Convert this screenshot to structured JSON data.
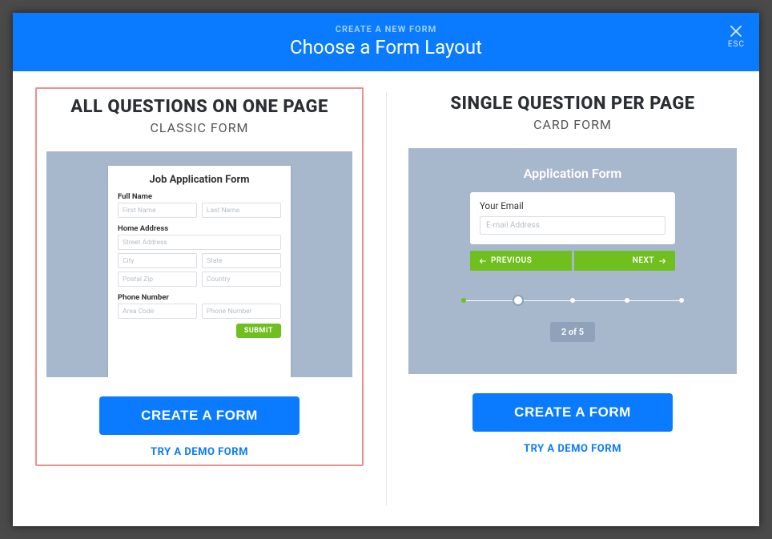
{
  "header": {
    "eyebrow": "CREATE A NEW FORM",
    "title": "Choose a Form Layout",
    "close_label": "ESC"
  },
  "options": {
    "classic": {
      "title": "ALL QUESTIONS ON ONE PAGE",
      "subtitle": "CLASSIC FORM",
      "create_label": "CREATE A FORM",
      "demo_label": "TRY A DEMO FORM",
      "preview": {
        "form_title": "Job Application Form",
        "full_name_label": "Full Name",
        "first_name_ph": "First Name",
        "last_name_ph": "Last Name",
        "home_address_label": "Home Address",
        "street_ph": "Street Address",
        "city_ph": "City",
        "state_ph": "State",
        "postal_ph": "Postal Zip",
        "country_ph": "Country",
        "phone_label": "Phone Number",
        "area_code_ph": "Area Code",
        "phone_ph": "Phone Number",
        "submit_label": "SUBMIT"
      }
    },
    "card": {
      "title": "SINGLE QUESTION PER PAGE",
      "subtitle": "CARD FORM",
      "create_label": "CREATE A FORM",
      "demo_label": "TRY A DEMO FORM",
      "preview": {
        "form_title": "Application Form",
        "question_label": "Your Email",
        "input_ph": "E-mail Address",
        "prev_label": "PREVIOUS",
        "next_label": "NEXT",
        "step_text": "2 of 5"
      }
    }
  }
}
